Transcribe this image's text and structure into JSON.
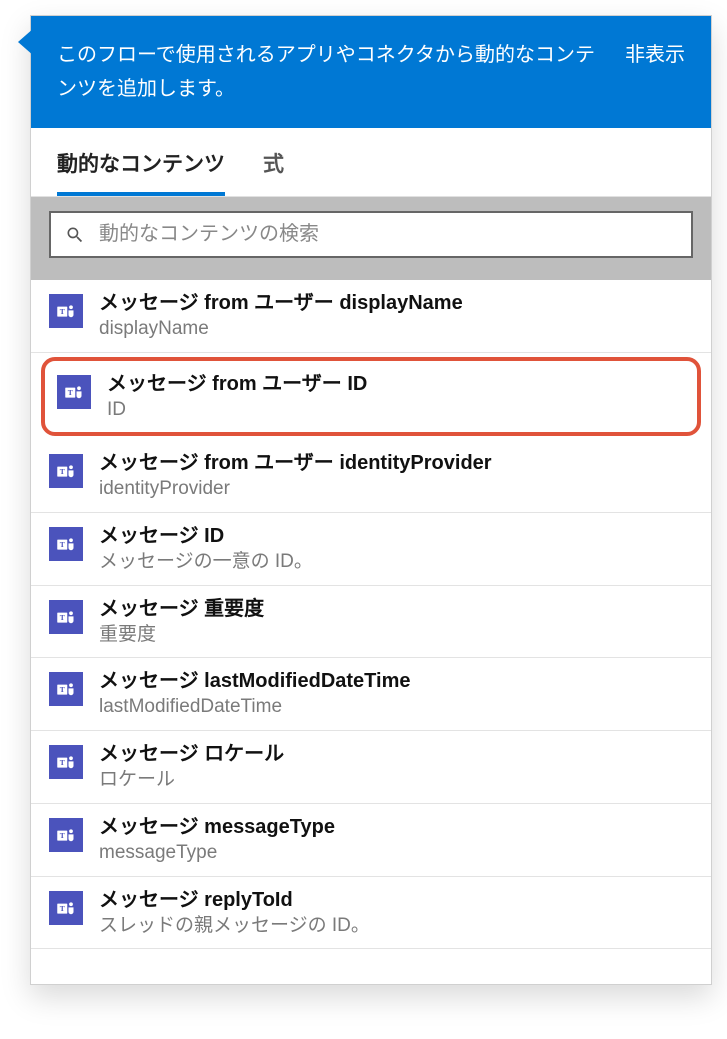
{
  "header": {
    "description": "このフローで使用されるアプリやコネクタから動的なコンテンツを追加します。",
    "hide_label": "非表示"
  },
  "tabs": {
    "dynamic_content": "動的なコンテンツ",
    "expression": "式"
  },
  "search": {
    "placeholder": "動的なコンテンツの検索"
  },
  "icon_name": "teams-icon",
  "items": [
    {
      "title": "メッセージ from ユーザー displayName",
      "desc": "displayName",
      "highlighted": false
    },
    {
      "title": "メッセージ from ユーザー ID",
      "desc": "ID",
      "highlighted": true
    },
    {
      "title": "メッセージ from ユーザー identityProvider",
      "desc": "identityProvider",
      "highlighted": false
    },
    {
      "title": "メッセージ ID",
      "desc": "メッセージの一意の ID。",
      "highlighted": false
    },
    {
      "title": "メッセージ 重要度",
      "desc": "重要度",
      "highlighted": false
    },
    {
      "title": "メッセージ lastModifiedDateTime",
      "desc": "lastModifiedDateTime",
      "highlighted": false
    },
    {
      "title": "メッセージ ロケール",
      "desc": "ロケール",
      "highlighted": false
    },
    {
      "title": "メッセージ messageType",
      "desc": "messageType",
      "highlighted": false
    },
    {
      "title": "メッセージ replyToId",
      "desc": "スレッドの親メッセージの ID。",
      "highlighted": false
    }
  ]
}
